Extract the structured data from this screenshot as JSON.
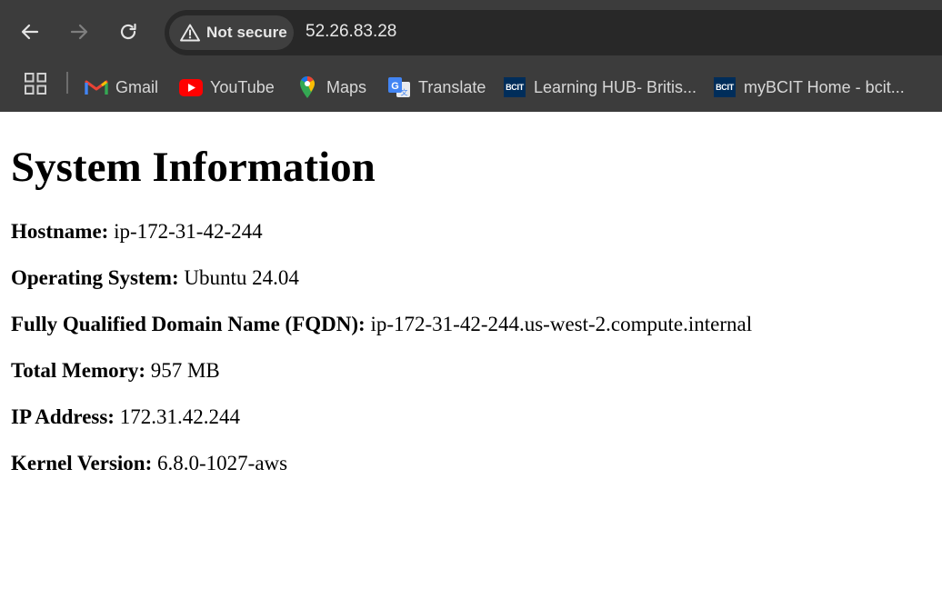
{
  "browser": {
    "security_label": "Not secure",
    "url": "52.26.83.28",
    "bookmarks": [
      {
        "label": "Gmail"
      },
      {
        "label": "YouTube"
      },
      {
        "label": "Maps"
      },
      {
        "label": "Translate"
      },
      {
        "label": "Learning HUB- Britis...",
        "icon_text": "BCIT"
      },
      {
        "label": "myBCIT Home - bcit...",
        "icon_text": "BCIT"
      }
    ]
  },
  "page": {
    "title": "System Information",
    "fields": [
      {
        "label": "Hostname:",
        "value": "ip-172-31-42-244"
      },
      {
        "label": "Operating System:",
        "value": "Ubuntu 24.04"
      },
      {
        "label": "Fully Qualified Domain Name (FQDN):",
        "value": "ip-172-31-42-244.us-west-2.compute.internal"
      },
      {
        "label": "Total Memory:",
        "value": "957 MB"
      },
      {
        "label": "IP Address:",
        "value": "172.31.42.244"
      },
      {
        "label": "Kernel Version:",
        "value": "6.8.0-1027-aws"
      }
    ]
  },
  "colors": {
    "chrome_bg": "#3c3c3c",
    "omnibox_bg": "#282828",
    "page_bg": "#ffffff"
  }
}
